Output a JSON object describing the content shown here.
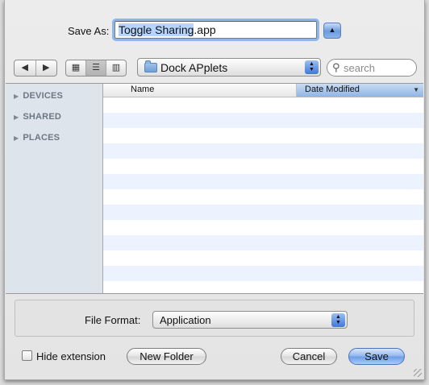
{
  "save_as": {
    "label": "Save As:",
    "filename_selected": "Toggle Sharing",
    "filename_extension": ".app"
  },
  "toolbar": {
    "back_glyph": "◀",
    "forward_glyph": "▶",
    "views": [
      {
        "name": "icon-view-icon",
        "glyph": "▦",
        "active": false
      },
      {
        "name": "list-view-icon",
        "glyph": "☰",
        "active": true
      },
      {
        "name": "column-view-icon",
        "glyph": "▥",
        "active": false
      }
    ],
    "location": "Dock APplets",
    "search_placeholder": "search"
  },
  "sidebar": {
    "items": [
      {
        "label": "DEVICES"
      },
      {
        "label": "SHARED"
      },
      {
        "label": "PLACES"
      }
    ]
  },
  "file_list": {
    "columns": {
      "name": "Name",
      "date": "Date Modified"
    },
    "sorted_column": "date",
    "rows": []
  },
  "format": {
    "label": "File Format:",
    "value": "Application"
  },
  "bottom": {
    "hide_extension_label": "Hide extension",
    "hide_extension_checked": false,
    "new_folder_label": "New Folder",
    "cancel_label": "Cancel",
    "save_label": "Save"
  },
  "colors": {
    "accent": "#6c9ce7",
    "sidebar_bg": "#dde4ec",
    "stripe": "#edf3fe"
  }
}
